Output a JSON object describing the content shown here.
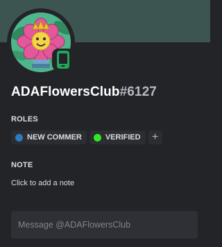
{
  "profile": {
    "username": "ADAFlowersClub",
    "discriminator": "#6127",
    "status": "mobile-online",
    "avatar_icon": "flower-avatar"
  },
  "colors": {
    "banner": "#3d5550",
    "card_background": "#232428",
    "status_online": "#23a55a"
  },
  "roles": {
    "title": "ROLES",
    "items": [
      {
        "label": "NEW COMMER",
        "color": "#2d7bc1"
      },
      {
        "label": "VERIFIED",
        "color": "#2bea25"
      }
    ],
    "add_label": "+"
  },
  "note": {
    "title": "NOTE",
    "placeholder": "Click to add a note"
  },
  "message": {
    "placeholder": "Message @ADAFlowersClub",
    "value": ""
  }
}
